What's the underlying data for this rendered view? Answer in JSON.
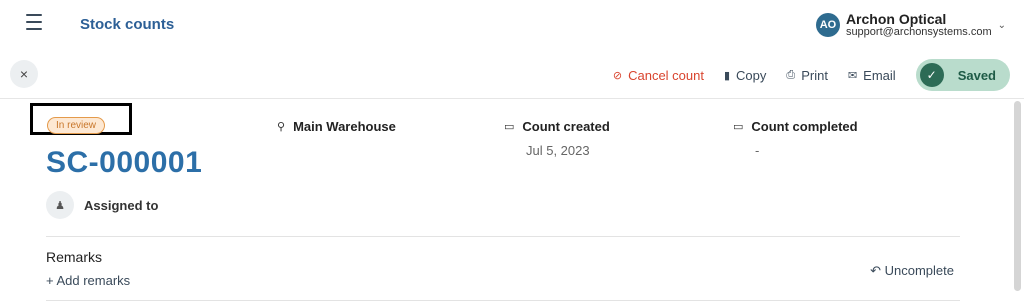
{
  "header": {
    "title": "Stock counts",
    "account": {
      "initials": "AO",
      "name": "Archon Optical",
      "email": "support@archonsystems.com"
    }
  },
  "toolbar": {
    "close_label": "×",
    "cancel_label": "Cancel count",
    "copy_label": "Copy",
    "print_label": "Print",
    "email_label": "Email",
    "saved_label": "Saved"
  },
  "document": {
    "status": "In review",
    "id": "SC-000001",
    "warehouse": "Main Warehouse",
    "count_created_label": "Count created",
    "count_created_value": "Jul 5, 2023",
    "count_completed_label": "Count completed",
    "count_completed_value": "-",
    "assigned_label": "Assigned to",
    "remarks_label": "Remarks",
    "add_remarks_label": "+ Add remarks",
    "uncomplete_label": "Uncomplete"
  },
  "colors": {
    "accent": "#2c6fa8",
    "cancel": "#d9442e",
    "saved_bg": "#b9dccc",
    "status_badge": "#fde8d3"
  },
  "icons": {
    "menu": "hamburger-icon",
    "close": "close-icon",
    "cancel": "ban-icon",
    "copy": "copy-icon",
    "print": "printer-icon",
    "email": "envelope-icon",
    "saved": "check-icon",
    "warehouse": "location-pin-icon",
    "created": "calendar-icon",
    "completed": "calendar-icon",
    "assignee": "user-icon",
    "uncomplete": "undo-icon"
  }
}
